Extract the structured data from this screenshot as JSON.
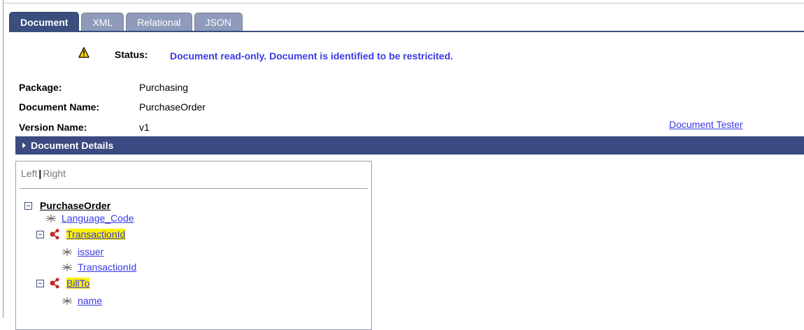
{
  "tabs": [
    {
      "label": "Document",
      "active": true
    },
    {
      "label": "XML",
      "active": false
    },
    {
      "label": "Relational",
      "active": false
    },
    {
      "label": "JSON",
      "active": false
    }
  ],
  "status": {
    "icon": "warning-icon",
    "label": "Status:",
    "text": "Document read-only.  Document is identified to be restricited."
  },
  "fields": {
    "package_label": "Package:",
    "package_value": "Purchasing",
    "document_name_label": "Document Name:",
    "document_name_value": "PurchaseOrder",
    "version_name_label": "Version Name:",
    "version_name_value": "v1"
  },
  "document_tester_link": "Document Tester",
  "details_section": {
    "label": "Document Details",
    "collapsed": true
  },
  "tree_panel": {
    "left_label": "Left",
    "separator": "|",
    "right_label": "Right",
    "root": "PurchaseOrder",
    "nodes": [
      {
        "label": "Language_Code",
        "type": "element"
      },
      {
        "label": "TransactionId",
        "type": "compound",
        "highlighted": true
      },
      {
        "label": "issuer",
        "type": "element"
      },
      {
        "label": "TransactionId",
        "type": "element"
      },
      {
        "label": "BillTo",
        "type": "compound",
        "highlighted": true
      },
      {
        "label": "name",
        "type": "element"
      }
    ]
  },
  "colors": {
    "tab_active": "#3a4f7e",
    "tab_inactive": "#8e9bbb",
    "link": "#3a3ae8",
    "highlight": "#fff200",
    "section_bar": "#3b4a80"
  }
}
